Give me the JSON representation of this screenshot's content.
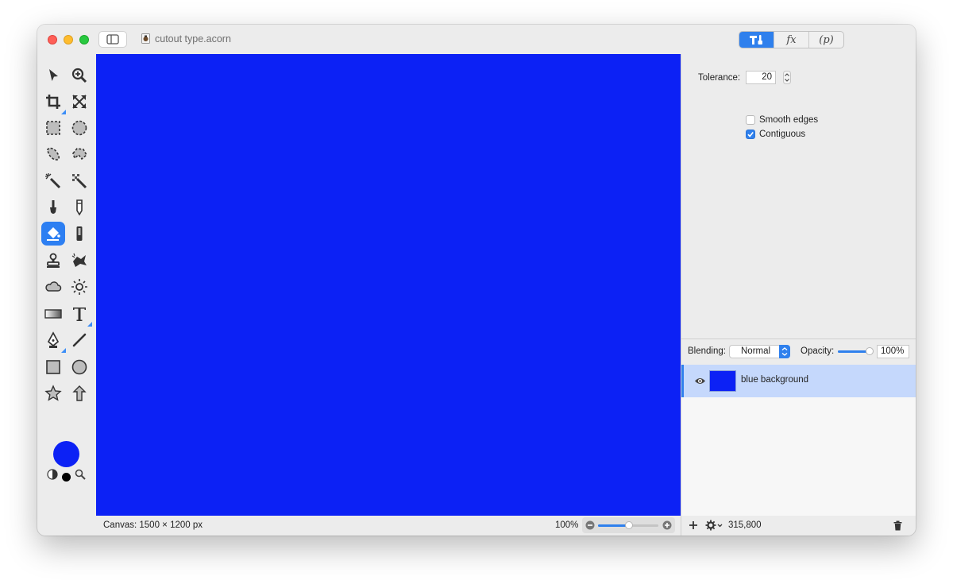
{
  "window": {
    "doc_title": "cutout type.acorn",
    "mode_segments": [
      {
        "label": "",
        "icon": "tools-icon",
        "selected": true
      },
      {
        "label": "fx",
        "icon": "fx-icon",
        "selected": false
      },
      {
        "label": "(p)",
        "icon": "properties-icon",
        "selected": false
      }
    ]
  },
  "tools": [
    {
      "name": "arrow-tool",
      "icon": "arrow-icon"
    },
    {
      "name": "zoom-tool",
      "icon": "zoom-icon"
    },
    {
      "name": "crop-tool",
      "icon": "crop-icon"
    },
    {
      "name": "transform-tool",
      "icon": "resize-arrows-icon"
    },
    {
      "name": "rect-select-tool",
      "icon": "marquee-rect-icon"
    },
    {
      "name": "ellipse-select-tool",
      "icon": "marquee-ellipse-icon"
    },
    {
      "name": "lasso-tool",
      "icon": "lasso-icon"
    },
    {
      "name": "polygon-lasso-tool",
      "icon": "polygon-lasso-icon"
    },
    {
      "name": "magic-wand-tool",
      "icon": "magic-wand-icon"
    },
    {
      "name": "instant-alpha-tool",
      "icon": "instant-alpha-icon"
    },
    {
      "name": "brush-tool",
      "icon": "brush-icon"
    },
    {
      "name": "pencil-tool",
      "icon": "pencil-icon"
    },
    {
      "name": "paint-bucket-tool",
      "icon": "paint-bucket-icon",
      "active": true
    },
    {
      "name": "eraser-tool",
      "icon": "eraser-icon"
    },
    {
      "name": "clone-tool",
      "icon": "clone-stamp-icon"
    },
    {
      "name": "smudge-tool",
      "icon": "smudge-icon"
    },
    {
      "name": "burn-tool",
      "icon": "cloud-icon"
    },
    {
      "name": "dodge-tool",
      "icon": "sun-icon"
    },
    {
      "name": "gradient-tool",
      "icon": "gradient-icon"
    },
    {
      "name": "text-tool",
      "icon": "text-icon"
    },
    {
      "name": "pen-tool",
      "icon": "pen-icon"
    },
    {
      "name": "line-tool",
      "icon": "line-icon"
    },
    {
      "name": "rectangle-tool",
      "icon": "rectangle-icon"
    },
    {
      "name": "oval-tool",
      "icon": "circle-icon"
    },
    {
      "name": "star-tool",
      "icon": "star-icon"
    },
    {
      "name": "arrow-shape-tool",
      "icon": "up-arrow-icon"
    }
  ],
  "colors": {
    "foreground": "#0c21f5",
    "accent": "#2f80ed",
    "canvas_fill": "#0c21f5"
  },
  "inspector": {
    "tolerance_label": "Tolerance:",
    "tolerance_value": "20",
    "smooth_edges_label": "Smooth edges",
    "smooth_edges_checked": false,
    "contiguous_label": "Contiguous",
    "contiguous_checked": true
  },
  "layers": {
    "blending_label": "Blending:",
    "blending_value": "Normal",
    "opacity_label": "Opacity:",
    "opacity_value": "100%",
    "items": [
      {
        "name": "blue background",
        "visible": true,
        "selected": true
      }
    ],
    "count": "315,800"
  },
  "status": {
    "canvas_info": "Canvas: 1500 × 1200 px",
    "zoom": "100%"
  }
}
